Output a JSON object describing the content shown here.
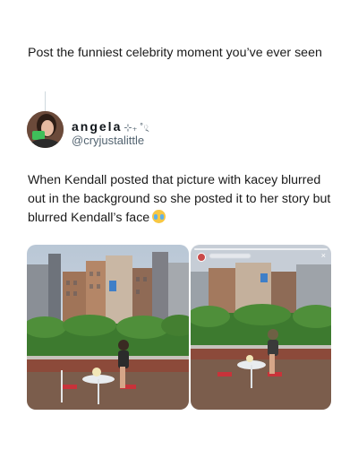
{
  "post": {
    "title": "Post the funniest celebrity moment you’ve ever seen"
  },
  "tweet": {
    "author_name": "angela",
    "author_name_decoration": "⊹₊ ˚྄",
    "author_handle": "@cryjustalittle",
    "text": "When Kendall posted that picture with kacey blurred out in the background so she posted it to her story but blurred Kendall’s face",
    "emoji_icon": "loudly-crying-face-icon"
  },
  "media": {
    "images": [
      {
        "description_icon": "photo-rooftop-icon"
      },
      {
        "description_icon": "story-screenshot-icon",
        "close_glyph": "×"
      }
    ]
  },
  "colors": {
    "background": "#ffffff",
    "text": "#0f1419",
    "secondary_text": "#536471",
    "thread_line": "#cfd9de"
  }
}
